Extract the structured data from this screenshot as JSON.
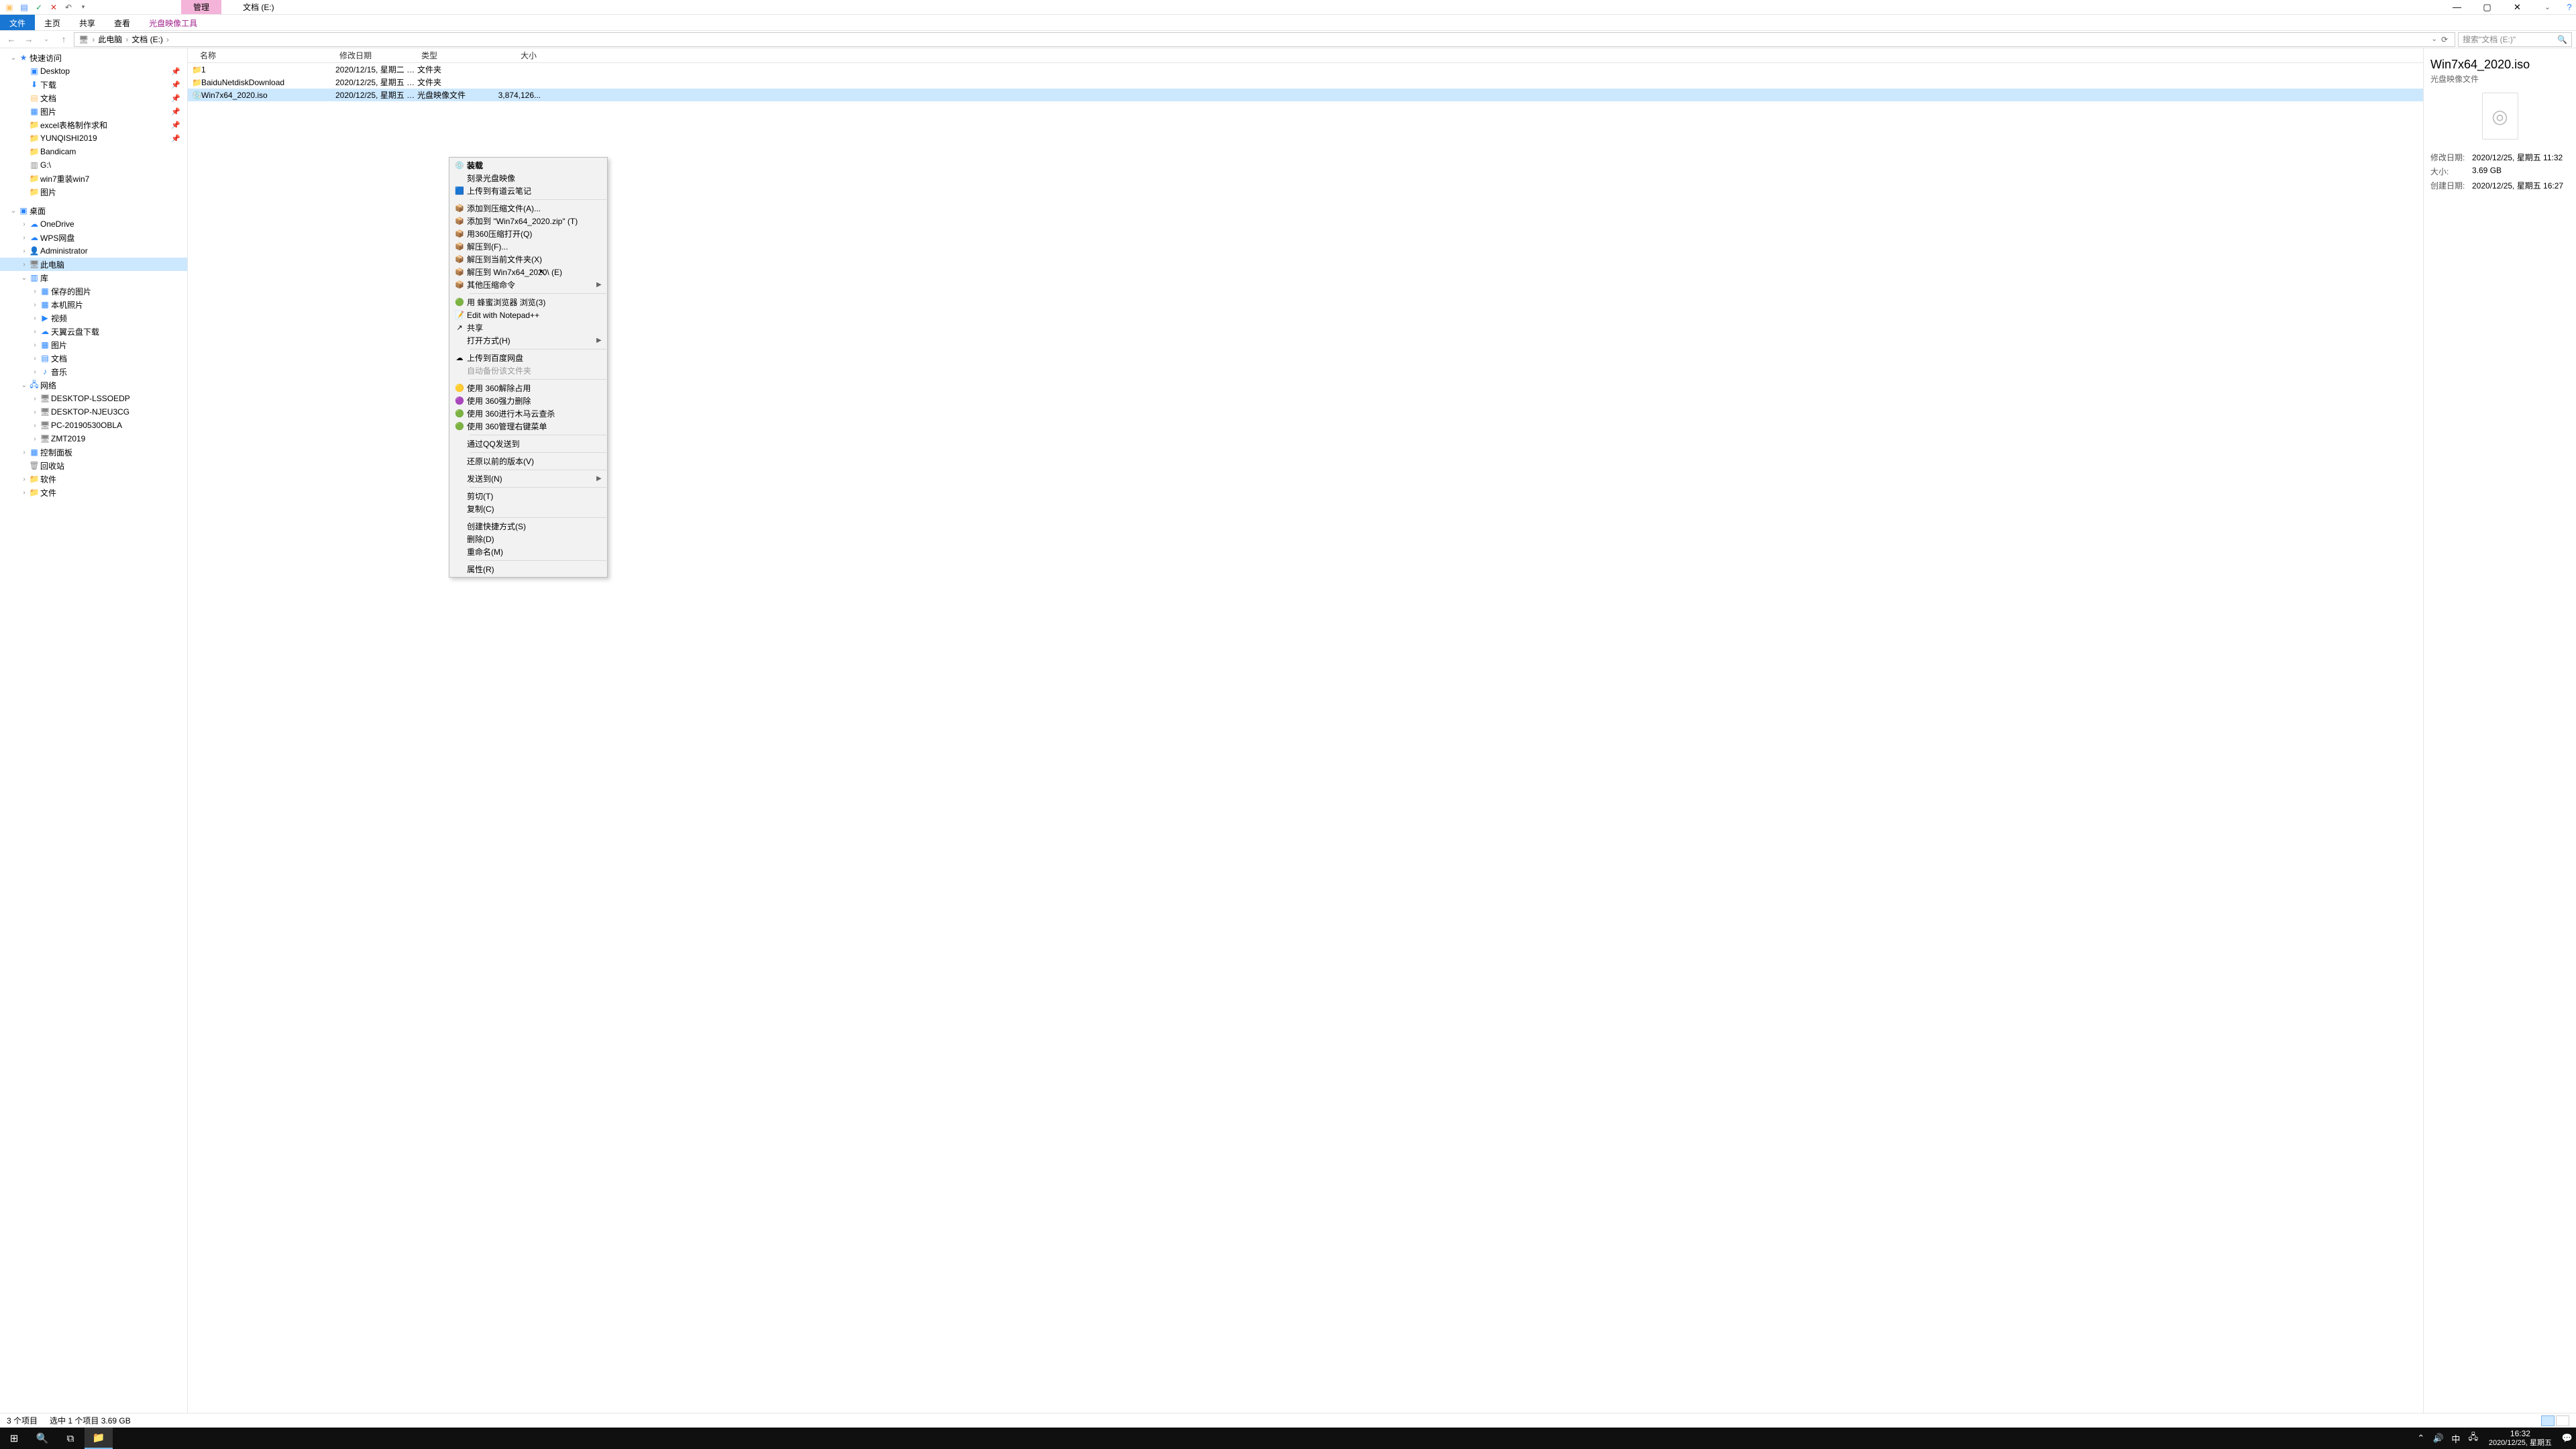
{
  "window": {
    "context_tab": "管理",
    "title": "文档 (E:)",
    "min": "—",
    "max": "▢",
    "close": "✕",
    "expand": "⌄",
    "help": "?"
  },
  "ribbon": {
    "file": "文件",
    "home": "主页",
    "share": "共享",
    "view": "查看",
    "tool": "光盘映像工具"
  },
  "nav": {
    "back": "←",
    "fwd": "→",
    "recent": "⌄",
    "up": "↑",
    "crumbs": [
      "此电脑",
      "文档 (E:)"
    ],
    "sep": "›",
    "refresh": "⟳",
    "drop": "⌄",
    "search_placeholder": "搜索\"文档 (E:)\"",
    "search_icon": "🔍"
  },
  "tree": {
    "quick": "快速访问",
    "q": [
      "Desktop",
      "下载",
      "文档",
      "图片",
      "excel表格制作求和",
      "YUNQISHI2019",
      "Bandicam",
      "G:\\",
      "win7重装win7",
      "图片"
    ],
    "desktop": "桌面",
    "d": [
      "OneDrive",
      "WPS网盘",
      "Administrator",
      "此电脑",
      "库"
    ],
    "lib": [
      "保存的图片",
      "本机照片",
      "视频",
      "天翼云盘下载",
      "图片",
      "文档",
      "音乐"
    ],
    "net": "网络",
    "n": [
      "DESKTOP-LSSOEDP",
      "DESKTOP-NJEU3CG",
      "PC-20190530OBLA",
      "ZMT2019"
    ],
    "cp": "控制面板",
    "rb": "回收站",
    "soft": "软件",
    "docs": "文件"
  },
  "cols": {
    "name": "名称",
    "date": "修改日期",
    "type": "类型",
    "size": "大小"
  },
  "files": [
    {
      "ic": "📁",
      "n": "1",
      "d": "2020/12/15, 星期二 1...",
      "t": "文件夹",
      "s": ""
    },
    {
      "ic": "📁",
      "n": "BaiduNetdiskDownload",
      "d": "2020/12/25, 星期五 1...",
      "t": "文件夹",
      "s": ""
    },
    {
      "ic": "💿",
      "n": "Win7x64_2020.iso",
      "d": "2020/12/25, 星期五 1...",
      "t": "光盘映像文件",
      "s": "3,874,126..."
    }
  ],
  "ctx": {
    "groups": [
      [
        {
          "i": "💿",
          "l": "装载",
          "bold": true
        },
        {
          "i": "",
          "l": "刻录光盘映像"
        },
        {
          "i": "🟦",
          "l": "上传到有道云笔记"
        }
      ],
      [
        {
          "i": "📦",
          "l": "添加到压缩文件(A)..."
        },
        {
          "i": "📦",
          "l": "添加到 \"Win7x64_2020.zip\" (T)"
        },
        {
          "i": "📦",
          "l": "用360压缩打开(Q)"
        },
        {
          "i": "📦",
          "l": "解压到(F)..."
        },
        {
          "i": "📦",
          "l": "解压到当前文件夹(X)"
        },
        {
          "i": "📦",
          "l": "解压到 Win7x64_2020\\ (E)"
        },
        {
          "i": "📦",
          "l": "其他压缩命令",
          "arr": true
        }
      ],
      [
        {
          "i": "🟢",
          "l": "用 蜂蜜浏览器 浏览(3)"
        },
        {
          "i": "📝",
          "l": "Edit with Notepad++"
        },
        {
          "i": "↗",
          "l": "共享"
        },
        {
          "i": "",
          "l": "打开方式(H)",
          "arr": true
        }
      ],
      [
        {
          "i": "☁",
          "l": "上传到百度网盘"
        },
        {
          "i": "",
          "l": "自动备份该文件夹",
          "dis": true
        }
      ],
      [
        {
          "i": "🟡",
          "l": "使用 360解除占用"
        },
        {
          "i": "🟣",
          "l": "使用 360强力删除"
        },
        {
          "i": "🟢",
          "l": "使用 360进行木马云查杀"
        },
        {
          "i": "🟢",
          "l": "使用 360管理右键菜单"
        }
      ],
      [
        {
          "i": "",
          "l": "通过QQ发送到"
        }
      ],
      [
        {
          "i": "",
          "l": "还原以前的版本(V)"
        }
      ],
      [
        {
          "i": "",
          "l": "发送到(N)",
          "arr": true
        }
      ],
      [
        {
          "i": "",
          "l": "剪切(T)"
        },
        {
          "i": "",
          "l": "复制(C)"
        }
      ],
      [
        {
          "i": "",
          "l": "创建快捷方式(S)"
        },
        {
          "i": "",
          "l": "删除(D)"
        },
        {
          "i": "",
          "l": "重命名(M)"
        }
      ],
      [
        {
          "i": "",
          "l": "属性(R)"
        }
      ]
    ]
  },
  "details": {
    "title": "Win7x64_2020.iso",
    "sub": "光盘映像文件",
    "thumb": "◎",
    "rows": [
      {
        "l": "修改日期:",
        "v": "2020/12/25, 星期五 11:32"
      },
      {
        "l": "大小:",
        "v": "3.69 GB"
      },
      {
        "l": "创建日期:",
        "v": "2020/12/25, 星期五 16:27"
      }
    ]
  },
  "status": {
    "a": "3 个项目",
    "b": "选中 1 个项目  3.69 GB"
  },
  "taskbar": {
    "start": "⊞",
    "search": "🔍",
    "tasks": "⧉",
    "explorer": "📁",
    "up": "⌃",
    "vol": "🔊",
    "ime": "中",
    "net": "🖧",
    "nc": "💬",
    "time": "16:32",
    "date": "2020/12/25, 星期五"
  }
}
